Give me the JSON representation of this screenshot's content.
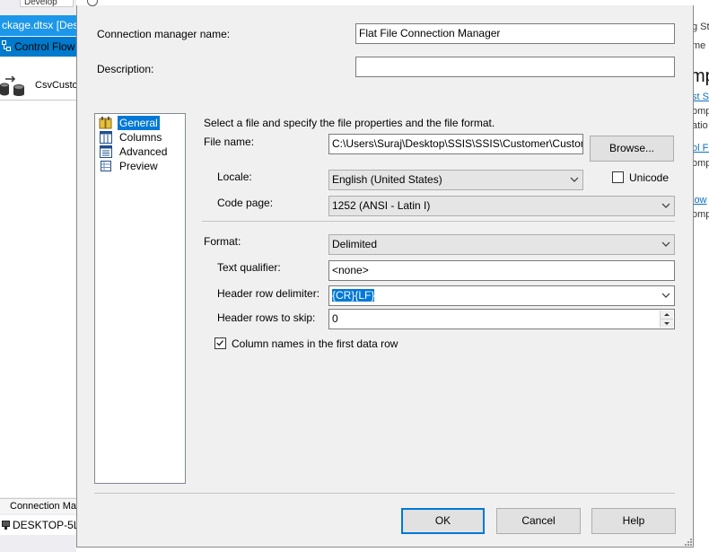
{
  "background": {
    "top_dropdown": "Develop",
    "package_tab": "ckage.dtsx [Des",
    "control_flow_tab": "Control Flow",
    "csv_task": "CsvCustor",
    "connection_managers_tab": "Connection Ma",
    "connection_manager_item": "DESKTOP-5LL",
    "right_panel": [
      "g St",
      "me",
      "mp",
      "st S",
      "omp",
      "atio",
      "ol Fl",
      "omp",
      "low",
      "omp"
    ]
  },
  "dialog": {
    "connection_manager_name_label": "Connection manager name:",
    "connection_manager_name_value": "Flat File Connection Manager",
    "description_label": "Description:",
    "description_value": "",
    "nav": [
      {
        "label": "General",
        "icon": "general-icon",
        "selected": true
      },
      {
        "label": "Columns",
        "icon": "columns-icon",
        "selected": false
      },
      {
        "label": "Advanced",
        "icon": "advanced-icon",
        "selected": false
      },
      {
        "label": "Preview",
        "icon": "preview-icon",
        "selected": false
      }
    ],
    "instruction": "Select a file and specify the file properties and the file format.",
    "file_name_label": "File name:",
    "file_name_value": "C:\\Users\\Suraj\\Desktop\\SSIS\\SSIS\\Customer\\Custom",
    "browse_button": "Browse...",
    "locale_label": "Locale:",
    "locale_value": "English (United States)",
    "unicode_label": "Unicode",
    "unicode_checked": false,
    "code_page_label": "Code page:",
    "code_page_value": "1252  (ANSI - Latin I)",
    "format_label": "Format:",
    "format_value": "Delimited",
    "text_qualifier_label": "Text qualifier:",
    "text_qualifier_value": "<none>",
    "header_row_delimiter_label": "Header row delimiter:",
    "header_row_delimiter_value": "{CR}{LF}",
    "header_rows_to_skip_label": "Header rows to skip:",
    "header_rows_to_skip_value": "0",
    "column_names_label": "Column names in the first data row",
    "column_names_checked": true,
    "ok_button": "OK",
    "cancel_button": "Cancel",
    "help_button": "Help"
  },
  "colors": {
    "accent": "#0078d7",
    "vs_blue": "#007acc",
    "dialog_bg": "#f0f0f0"
  }
}
